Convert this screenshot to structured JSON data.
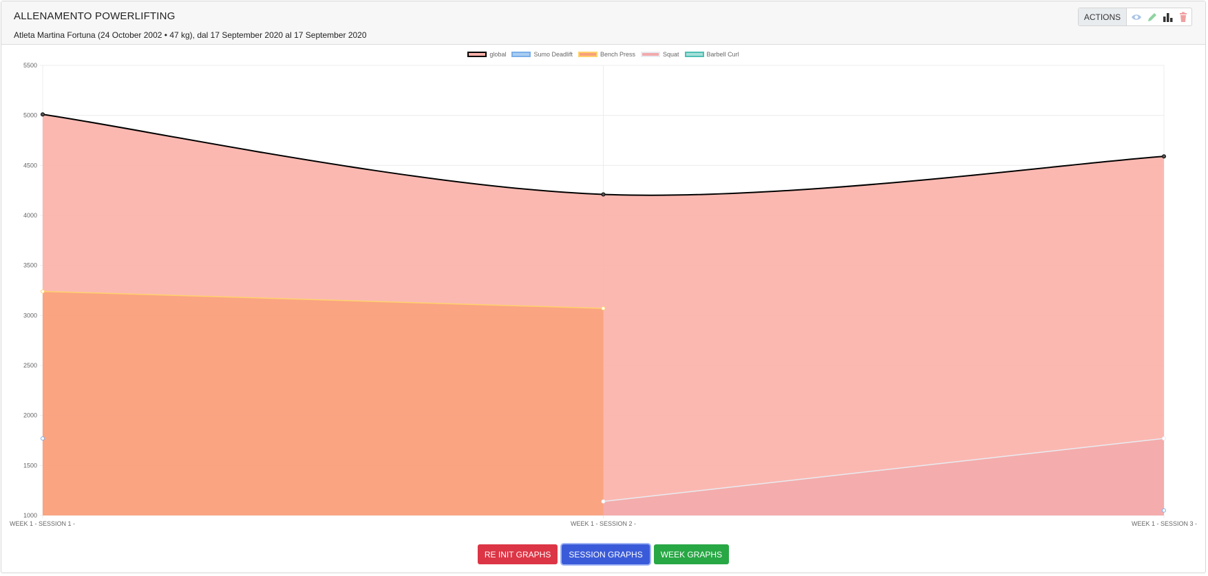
{
  "header": {
    "title": "ALLENAMENTO POWERLIFTING",
    "subtitle": "Atleta Martina Fortuna (24 October 2002 • 47 kg), dal 17 September 2020 al 17 September 2020"
  },
  "actions": {
    "label": "ACTIONS",
    "icons": [
      "eye-icon",
      "pencil-icon",
      "bar-chart-icon",
      "trash-icon"
    ]
  },
  "buttons": {
    "reinit": "RE INIT GRAPHS",
    "session": "SESSION GRAPHS",
    "week": "WEEK GRAPHS"
  },
  "chart_data": {
    "type": "area",
    "categories": [
      "WEEK 1 - SESSION 1 -",
      "WEEK 1 - SESSION 2 -",
      "WEEK 1 - SESSION 3 -"
    ],
    "ylim": [
      1000,
      5500
    ],
    "yticks": [
      1000,
      1500,
      2000,
      2500,
      3000,
      3500,
      4000,
      4500,
      5000,
      5500
    ],
    "grid": true,
    "legend_position": "top",
    "series": [
      {
        "name": "global",
        "values": [
          5010,
          4210,
          4590
        ],
        "border": "#000000",
        "fill": "#fbb0a8"
      },
      {
        "name": "Sumo Deadlift",
        "values": [
          1770,
          null,
          1050
        ],
        "border": "#7aaee8",
        "fill": "#a9cdf2"
      },
      {
        "name": "Bench Press",
        "values": [
          3240,
          3070,
          null
        ],
        "border": "#ffd26b",
        "fill": "#f9a07a"
      },
      {
        "name": "Squat",
        "values": [
          null,
          1140,
          1770
        ],
        "border": "#e8ecf2",
        "fill": "#f2aaac"
      },
      {
        "name": "Barbell Curl",
        "values": [
          null,
          null,
          null
        ],
        "border": "#4dbfb3",
        "fill": "#a6dfd9"
      }
    ]
  }
}
